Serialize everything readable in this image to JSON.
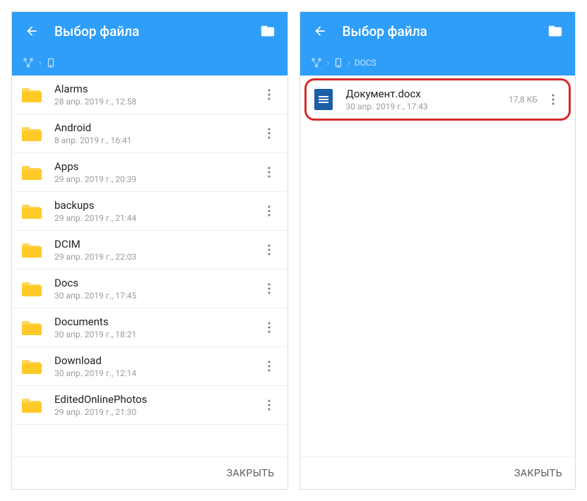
{
  "left": {
    "title": "Выбор файла",
    "breadcrumb": [],
    "items": [
      {
        "name": "Alarms",
        "date": "28 апр. 2019 г., 12:58"
      },
      {
        "name": "Android",
        "date": "8 апр. 2019 г., 16:41"
      },
      {
        "name": "Apps",
        "date": "29 апр. 2019 г., 20:39"
      },
      {
        "name": "backups",
        "date": "29 апр. 2019 г., 21:44"
      },
      {
        "name": "DCIM",
        "date": "29 апр. 2019 г., 22:03"
      },
      {
        "name": "Docs",
        "date": "30 апр. 2019 г., 17:45"
      },
      {
        "name": "Documents",
        "date": "30 апр. 2019 г., 18:21"
      },
      {
        "name": "Download",
        "date": "30 апр. 2019 г., 12:14"
      },
      {
        "name": "EditedOnlinePhotos",
        "date": "29 апр. 2019 г., 21:30"
      }
    ],
    "close": "ЗАКРЫТЬ"
  },
  "right": {
    "title": "Выбор файла",
    "breadcrumb": [
      "DOCS"
    ],
    "file": {
      "name": "Документ.docx",
      "date": "30 апр. 2019 г., 17:43",
      "size": "17,8 КБ"
    },
    "close": "ЗАКРЫТЬ"
  }
}
